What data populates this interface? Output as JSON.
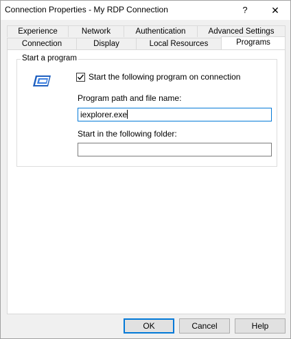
{
  "window": {
    "title": "Connection Properties - My RDP Connection",
    "help_glyph": "?",
    "close_glyph": "✕"
  },
  "tabs_row1": [
    "Experience",
    "Network",
    "Authentication",
    "Advanced Settings"
  ],
  "tabs_row2": [
    "Connection",
    "Display",
    "Local Resources",
    "Programs"
  ],
  "active_tab": "Programs",
  "group": {
    "label": "Start a program",
    "icon": "program-window-icon",
    "checkbox_label": "Start the following program on connection",
    "checkbox_checked": true,
    "path_label": "Program path and file name:",
    "path_value": "iexplorer.exe",
    "folder_label": "Start in the following folder:",
    "folder_value": ""
  },
  "buttons": {
    "ok": "OK",
    "cancel": "Cancel",
    "help": "Help"
  },
  "colors": {
    "focus_border": "#0078d7",
    "icon_blue": "#1e5fbf"
  }
}
